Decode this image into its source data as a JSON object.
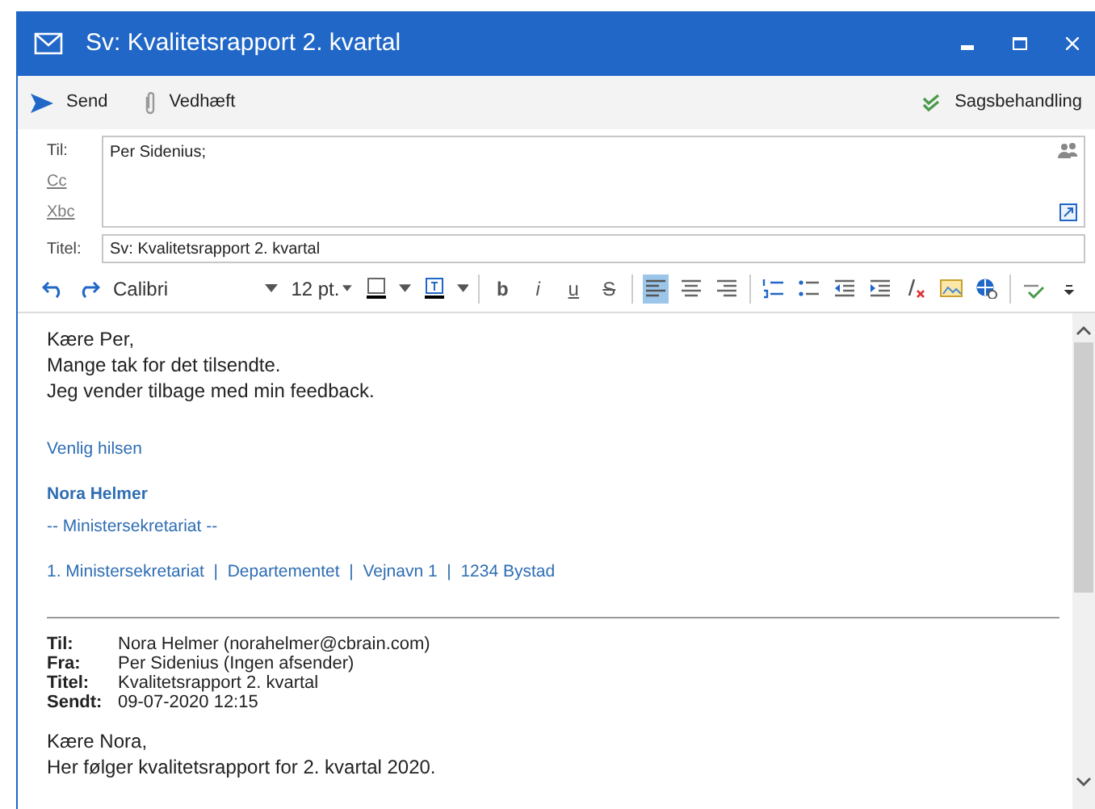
{
  "window": {
    "title": "Sv: Kvalitetsrapport 2. kvartal"
  },
  "toolbar": {
    "left": [
      {
        "kind": "send",
        "label": "Send"
      },
      {
        "kind": "attach",
        "label": "Vedhæft"
      }
    ],
    "right": [
      {
        "kind": "casework",
        "label": "Sagsbehandling"
      }
    ]
  },
  "address": {
    "fields": [
      {
        "label": "Til:",
        "value": "Per Sidenius;",
        "link": false
      },
      {
        "label": "Cc",
        "link": true
      },
      {
        "label": "Xbc",
        "link": true
      }
    ],
    "subject": {
      "label": "Titel:",
      "value": "Sv: Kvalitetsrapport 2. kvartal"
    }
  },
  "format_toolbar": {
    "font": "Calibri",
    "size": "12 pt.",
    "buttons": [
      {
        "kind": "undo",
        "selected": false
      },
      {
        "kind": "redo",
        "selected": false
      },
      {
        "kind": "font"
      },
      {
        "kind": "size"
      },
      {
        "kind": "highlight",
        "selected": false
      },
      {
        "kind": "fontcolor",
        "selected": false
      },
      {
        "kind": "sep"
      },
      {
        "kind": "letter",
        "label": "b",
        "selected": false
      },
      {
        "kind": "letter",
        "label": "i",
        "selected": false
      },
      {
        "kind": "letter",
        "label": "u",
        "selected": false
      },
      {
        "kind": "letter",
        "label": "S",
        "selected": false
      },
      {
        "kind": "sep"
      },
      {
        "kind": "align-left",
        "selected": true
      },
      {
        "kind": "align-center",
        "selected": false
      },
      {
        "kind": "align-right",
        "selected": false
      },
      {
        "kind": "sep"
      },
      {
        "kind": "numbered",
        "selected": false
      },
      {
        "kind": "bullets",
        "selected": false
      },
      {
        "kind": "outdent",
        "selected": false
      },
      {
        "kind": "indent",
        "selected": false
      },
      {
        "kind": "clear",
        "selected": false
      },
      {
        "kind": "image",
        "selected": false
      },
      {
        "kind": "link",
        "selected": false
      },
      {
        "kind": "sep"
      },
      {
        "kind": "spell",
        "selected": false
      },
      {
        "kind": "more",
        "selected": false
      }
    ]
  },
  "body": {
    "lines": [
      "Kære Per,",
      "Mange tak for det tilsendte.",
      "Jeg vender tilbage med min feedback."
    ],
    "signature": {
      "closing": "Venlig hilsen",
      "name": "Nora Helmer",
      "department": "-- Ministersekretariat --",
      "address": "1. Ministersekretariat  |  Departementet  |  Vejnavn 1  |  1234 Bystad"
    },
    "quoted_header": [
      {
        "label": "Til:",
        "value": "Nora Helmer (norahelmer@cbrain.com)"
      },
      {
        "label": "Fra:",
        "value": "Per Sidenius (Ingen afsender)"
      },
      {
        "label": "Titel:",
        "value": "Kvalitetsrapport 2. kvartal"
      },
      {
        "label": "Sendt:",
        "value": "09-07-2020 12:15"
      }
    ],
    "quoted_lines": [
      "Kære Nora,",
      "Her følger kvalitetsrapport for 2. kvartal 2020."
    ]
  }
}
